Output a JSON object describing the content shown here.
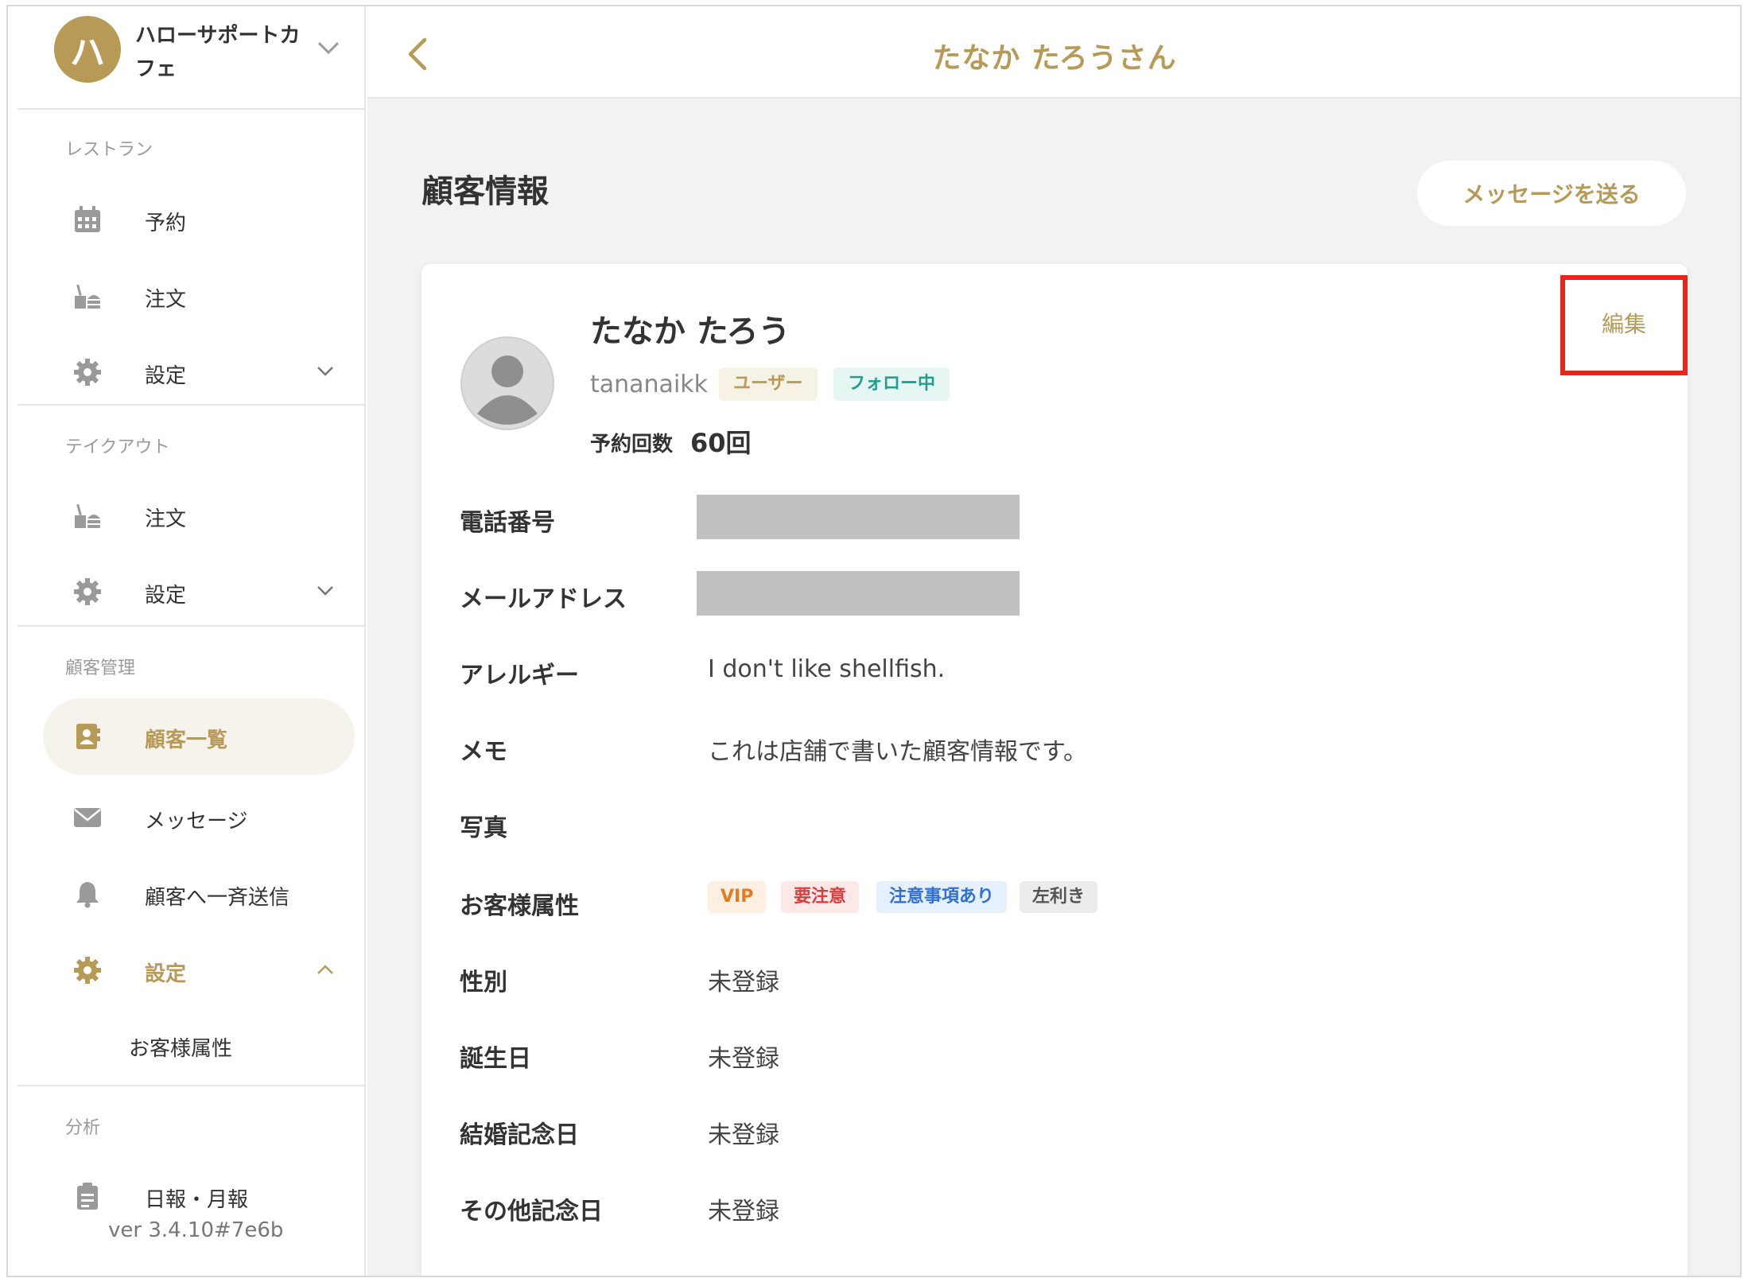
{
  "sidebar": {
    "brand": {
      "avatar_initial": "ハ",
      "name": "ハローサポートカフェ"
    },
    "sections": [
      {
        "label": "レストラン",
        "items": [
          {
            "label": "予約",
            "icon": "calendar-icon"
          },
          {
            "label": "注文",
            "icon": "food-icon"
          },
          {
            "label": "設定",
            "icon": "gear-icon"
          }
        ]
      },
      {
        "label": "テイクアウト",
        "items": [
          {
            "label": "注文",
            "icon": "food-icon"
          },
          {
            "label": "設定",
            "icon": "gear-icon"
          }
        ]
      },
      {
        "label": "顧客管理",
        "items": [
          {
            "label": "顧客一覧",
            "icon": "contact-book-icon",
            "active": true
          },
          {
            "label": "メッセージ",
            "icon": "envelope-icon"
          },
          {
            "label": "顧客へ一斉送信",
            "icon": "bell-icon"
          },
          {
            "label": "設定",
            "icon": "gear-icon"
          }
        ],
        "sub_items": [
          "お客様属性"
        ]
      },
      {
        "label": "分析",
        "items": [
          {
            "label": "日報・月報",
            "icon": "clipboard-icon"
          }
        ]
      }
    ],
    "version": "ver 3.4.10#7e6b"
  },
  "header": {
    "title": "たなか たろうさん"
  },
  "main": {
    "section_title": "顧客情報",
    "send_message_label": "メッセージを送る"
  },
  "customer": {
    "name": "たなか たろう",
    "username": "tananaikk",
    "tag_user": "ユーザー",
    "tag_follow": "フォロー中",
    "reservation_count_label": "予約回数",
    "reservation_count_value": "60回",
    "edit_label": "編集",
    "fields": [
      {
        "label": "電話番号",
        "value": ""
      },
      {
        "label": "メールアドレス",
        "value": ""
      },
      {
        "label": "アレルギー",
        "value": "I don't like shellfish."
      },
      {
        "label": "メモ",
        "value": "これは店舗で書いた顧客情報です。"
      },
      {
        "label": "写真",
        "value": ""
      },
      {
        "label": "お客様属性",
        "value": ""
      },
      {
        "label": "性別",
        "value": "未登録"
      },
      {
        "label": "誕生日",
        "value": "未登録"
      },
      {
        "label": "結婚記念日",
        "value": "未登録"
      },
      {
        "label": "その他記念日",
        "value": "未登録"
      }
    ],
    "attributes": [
      {
        "label": "VIP",
        "color": "#e8791e",
        "bg": "#fdf0e3"
      },
      {
        "label": "要注意",
        "color": "#e03b3b",
        "bg": "#fde8e8"
      },
      {
        "label": "注意事項あり",
        "color": "#2f6fd6",
        "bg": "#e6effc"
      },
      {
        "label": "左利き",
        "color": "#555555",
        "bg": "#ececec"
      }
    ]
  },
  "colors": {
    "accent": "#b89a57",
    "highlight": "#e8251a"
  }
}
